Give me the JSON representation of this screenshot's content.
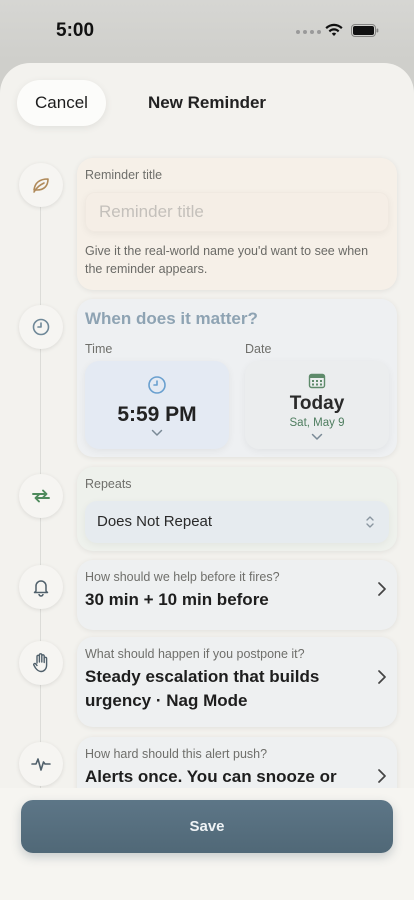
{
  "status_bar": {
    "time": "5:00"
  },
  "header": {
    "cancel_label": "Cancel",
    "title": "New Reminder"
  },
  "title_card": {
    "label": "Reminder title",
    "placeholder": "Reminder title",
    "hint": "Give it the real-world name you'd want to see when the reminder appears."
  },
  "when_card": {
    "heading": "When does it matter?",
    "time_label": "Time",
    "date_label": "Date",
    "time_value": "5:59 PM",
    "date_value": "Today",
    "date_sub": "Sat, May 9"
  },
  "repeats_card": {
    "label": "Repeats",
    "value": "Does Not Repeat"
  },
  "help_card": {
    "question": "How should we help before it fires?",
    "answer": "30 min + 10 min before"
  },
  "postpone_card": {
    "question": "What should happen if you postpone it?",
    "answer": "Steady escalation that builds urgency · Nag Mode"
  },
  "push_card": {
    "question": "How hard should this alert push?",
    "answer": "Alerts once. You can snooze or"
  },
  "footer": {
    "save_label": "Save"
  },
  "colors": {
    "accent": "#5a7283",
    "sage": "#4e7d5f",
    "muted_blue": "#8ea3b3",
    "sheet_bg": "#f3f2ee"
  },
  "icons": [
    "leaf-icon",
    "clock-icon",
    "repeat-icon",
    "bell-icon",
    "hand-icon",
    "pulse-icon",
    "calendar-icon"
  ]
}
